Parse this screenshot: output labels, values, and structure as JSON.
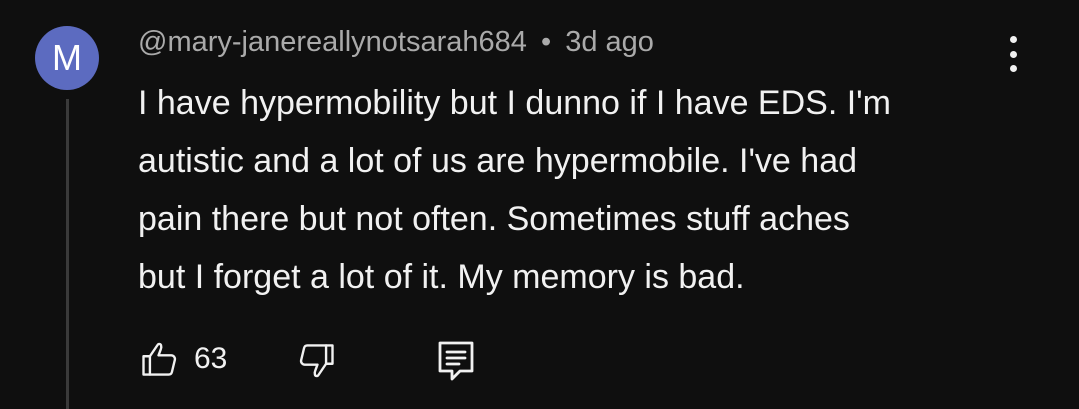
{
  "comment": {
    "avatar_letter": "M",
    "avatar_color": "#5c6bc0",
    "author": "@mary-janereallynotsarah684",
    "separator": "•",
    "timestamp": "3d ago",
    "text_lines": [
      "I have hypermobility but I dunno if I have EDS. I'm",
      "autistic and a lot of us are hypermobile. I've had",
      "pain there but not often. Sometimes stuff aches",
      "but I forget a lot of it. My memory is bad."
    ],
    "like_count": "63"
  },
  "icons": {
    "like": "thumbs-up-icon",
    "dislike": "thumbs-down-icon",
    "reply": "reply-comment-icon",
    "menu": "more-vertical-icon"
  },
  "colors": {
    "background": "#0f0f0f",
    "text_primary": "#f1f1f1",
    "text_secondary": "#aaaaaa"
  }
}
